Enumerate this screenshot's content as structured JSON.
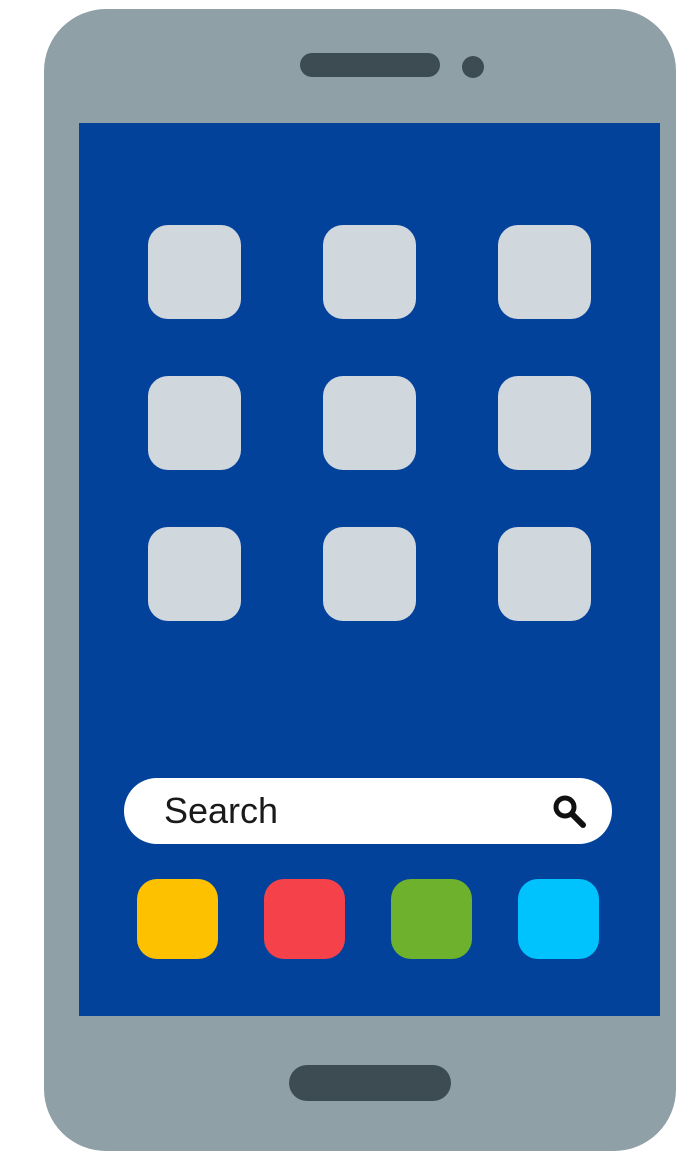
{
  "phone": {
    "body_color": "#8fa0a6",
    "speaker_color": "#3d4c53",
    "camera_color": "#3d4c53",
    "home_button_color": "#3d4c53",
    "screen_color": "#03429b"
  },
  "home_screen": {
    "app_icon_color": "#d0d8de",
    "app_grid": {
      "rows": 3,
      "columns": 3
    }
  },
  "search": {
    "label": "Search",
    "bar_color": "#ffffff",
    "icon": "search-icon",
    "icon_color": "#111111"
  },
  "dock": {
    "apps": [
      {
        "name": "dock-app-yellow",
        "color": "#fdc100"
      },
      {
        "name": "dock-app-red",
        "color": "#f4414a"
      },
      {
        "name": "dock-app-green",
        "color": "#6db12c"
      },
      {
        "name": "dock-app-blue",
        "color": "#00c3fd"
      }
    ]
  }
}
